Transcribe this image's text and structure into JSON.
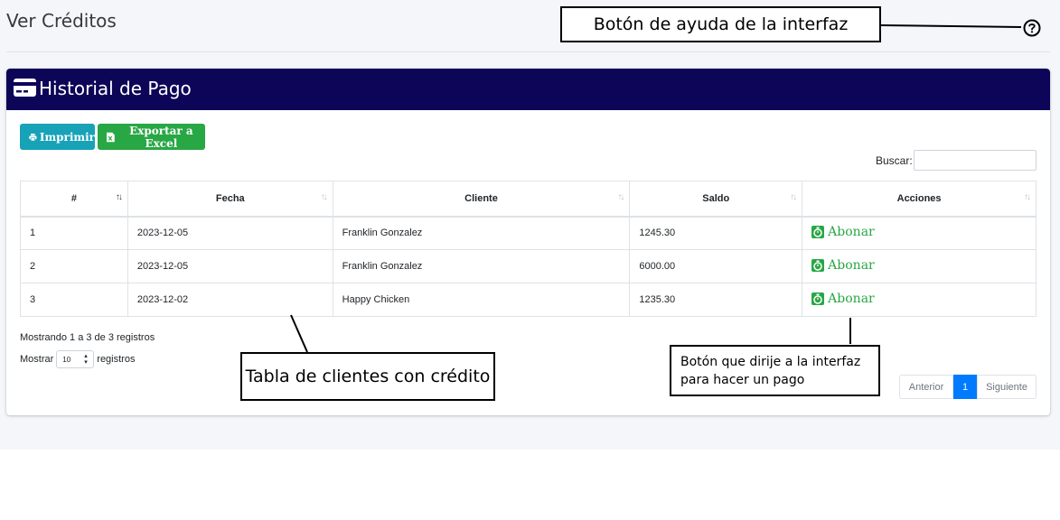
{
  "page": {
    "title": "Ver Créditos"
  },
  "card": {
    "title": "Historial de Pago"
  },
  "toolbar": {
    "print_label": "Imprimir",
    "excel_label": "Exportar a Excel"
  },
  "search": {
    "label": "Buscar:",
    "value": ""
  },
  "table": {
    "columns": [
      "#",
      "Fecha",
      "Cliente",
      "Saldo",
      "Acciones"
    ],
    "rows": [
      {
        "num": "1",
        "fecha": "2023-12-05",
        "cliente": "Franklin Gonzalez",
        "saldo": "1245.30",
        "accion": "Abonar"
      },
      {
        "num": "2",
        "fecha": "2023-12-05",
        "cliente": "Franklin Gonzalez",
        "saldo": "6000.00",
        "accion": "Abonar"
      },
      {
        "num": "3",
        "fecha": "2023-12-02",
        "cliente": "Happy Chicken",
        "saldo": "1235.30",
        "accion": "Abonar"
      }
    ]
  },
  "footer": {
    "info": "Mostrando 1 a 3 de 3 registros",
    "show_label": "Mostrar",
    "show_value": "10",
    "records_label": "registros"
  },
  "pagination": {
    "prev": "Anterior",
    "current": "1",
    "next": "Siguiente"
  },
  "annotations": {
    "help": "Botón de ayuda de la interfaz",
    "table": "Tabla de clientes con crédito",
    "button_line1": "Botón que dirije a la interfaz",
    "button_line2": "para hacer un pago"
  },
  "colors": {
    "header": "#0d0558",
    "print": "#17a2b8",
    "excel": "#28a745",
    "active_page": "#007bff"
  }
}
